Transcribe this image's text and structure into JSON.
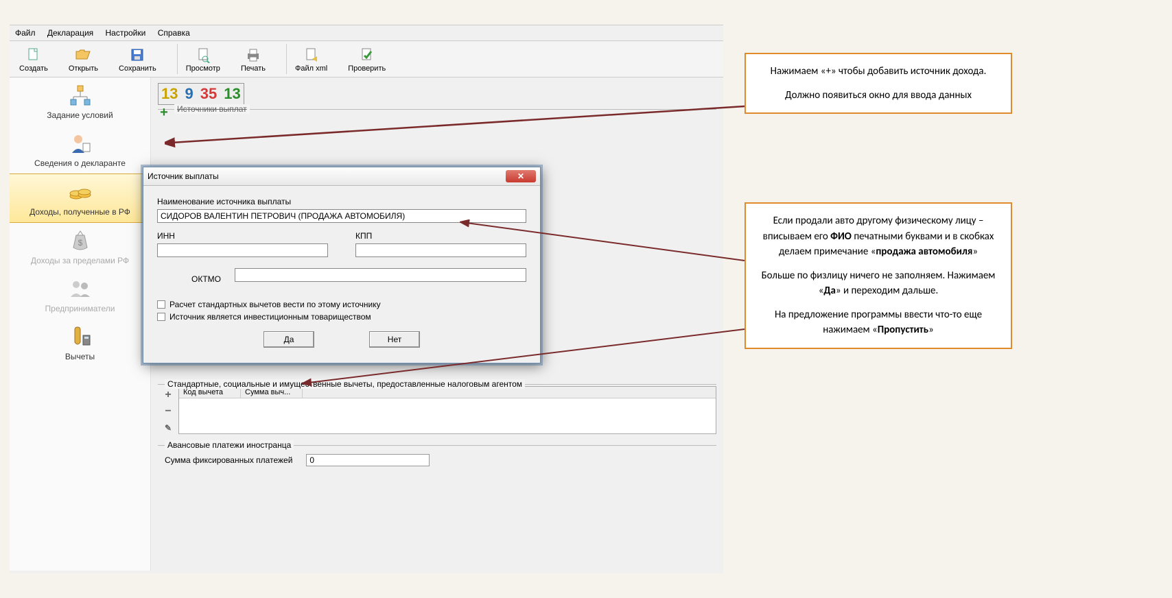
{
  "menu": {
    "file": "Файл",
    "declaration": "Декларация",
    "settings": "Настройки",
    "help": "Справка"
  },
  "toolbar": {
    "create": "Создать",
    "open": "Открыть",
    "save": "Сохранить",
    "preview": "Просмотр",
    "print": "Печать",
    "xml": "Файл xml",
    "check": "Проверить"
  },
  "sidebar": {
    "conditions": "Задание условий",
    "declarant": "Сведения о декларанте",
    "income_rf": "Доходы, полученные в РФ",
    "income_abroad": "Доходы за пределами РФ",
    "entrepreneurs": "Предприниматели",
    "deductions": "Вычеты"
  },
  "rates": {
    "r13a": "13",
    "r9": "9",
    "r35": "35",
    "r13b": "13"
  },
  "sources": {
    "header": "Источники выплат"
  },
  "deductions_section": {
    "title": "Стандартные, социальные и имущественные вычеты, предоставленные налоговым агентом",
    "col_code": "Код вычета",
    "col_sum": "Сумма выч..."
  },
  "advance": {
    "title": "Авансовые платежи иностранца",
    "label": "Сумма фиксированных платежей",
    "value": "0"
  },
  "dialog": {
    "title": "Источник выплаты",
    "name_label": "Наименование источника выплаты",
    "name_value": "СИДОРОВ ВАЛЕНТИН ПЕТРОВИЧ (ПРОДАЖА АВТОМОБИЛЯ)",
    "inn": "ИНН",
    "kpp": "КПП",
    "oktmo": "ОКТМО",
    "check1": "Расчет стандартных вычетов вести по этому источнику",
    "check2": "Источник является инвестиционным товариществом",
    "yes": "Да",
    "no": "Нет"
  },
  "annotation1": {
    "line1": "Нажимаем «+» чтобы добавить источник дохода.",
    "line2": "Должно появиться окно для ввода данных"
  },
  "annotation2": {
    "p1a": "Если продали авто другому физическому лицу – вписываем его ",
    "p1b": "ФИО",
    "p1c": " печатными буквами и в скобках делаем примечание «",
    "p1d": "продажа автомобиля",
    "p1e": "»",
    "p2a": "Больше по физлицу ничего не заполняем. Нажимаем «",
    "p2b": "Да",
    "p2c": "» и переходим дальше.",
    "p3a": "На предложение программы ввести что-то еще нажимаем «",
    "p3b": "Пропустить",
    "p3c": "»"
  }
}
